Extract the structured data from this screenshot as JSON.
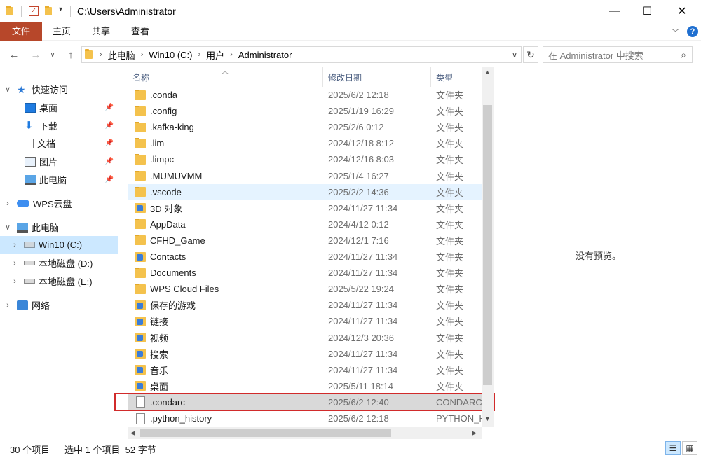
{
  "window": {
    "title": "C:\\Users\\Administrator",
    "minimize_label": "—",
    "maximize_label": "☐",
    "close_label": "✕"
  },
  "ribbon": {
    "tabs": [
      "文件",
      "主页",
      "共享",
      "查看"
    ]
  },
  "address": {
    "crumbs": [
      "此电脑",
      "Win10 (C:)",
      "用户",
      "Administrator"
    ],
    "search_placeholder": "在 Administrator 中搜索"
  },
  "nav": {
    "quick_access": "快速访问",
    "quick_items": [
      "桌面",
      "下载",
      "文档",
      "图片",
      "此电脑"
    ],
    "wps": "WPS云盘",
    "this_pc": "此电脑",
    "drives": [
      "Win10 (C:)",
      "本地磁盘 (D:)",
      "本地磁盘 (E:)"
    ],
    "network": "网络"
  },
  "list": {
    "columns": [
      "名称",
      "修改日期",
      "类型"
    ],
    "rows": [
      {
        "name": ".conda",
        "date": "2025/6/2 12:18",
        "type": "文件夹",
        "icon": "folder-icon"
      },
      {
        "name": ".config",
        "date": "2025/1/19 16:29",
        "type": "文件夹",
        "icon": "folder-icon"
      },
      {
        "name": ".kafka-king",
        "date": "2025/2/6 0:12",
        "type": "文件夹",
        "icon": "folder-icon"
      },
      {
        "name": ".lim",
        "date": "2024/12/18 8:12",
        "type": "文件夹",
        "icon": "folder-icon"
      },
      {
        "name": ".limpc",
        "date": "2024/12/16 8:03",
        "type": "文件夹",
        "icon": "folder-icon"
      },
      {
        "name": ".MUMUVMM",
        "date": "2025/1/4 16:27",
        "type": "文件夹",
        "icon": "folder-icon"
      },
      {
        "name": ".vscode",
        "date": "2025/2/2 14:36",
        "type": "文件夹",
        "icon": "folder-icon"
      },
      {
        "name": "3D 对象",
        "date": "2024/11/27 11:34",
        "type": "文件夹",
        "icon": "3d-objects-icon"
      },
      {
        "name": "AppData",
        "date": "2024/4/12 0:12",
        "type": "文件夹",
        "icon": "folder-icon"
      },
      {
        "name": "CFHD_Game",
        "date": "2024/12/1 7:16",
        "type": "文件夹",
        "icon": "folder-icon"
      },
      {
        "name": "Contacts",
        "date": "2024/11/27 11:34",
        "type": "文件夹",
        "icon": "contacts-icon"
      },
      {
        "name": "Documents",
        "date": "2024/11/27 11:34",
        "type": "文件夹",
        "icon": "folder-icon"
      },
      {
        "name": "WPS Cloud Files",
        "date": "2025/5/22 19:24",
        "type": "文件夹",
        "icon": "folder-icon"
      },
      {
        "name": "保存的游戏",
        "date": "2024/11/27 11:34",
        "type": "文件夹",
        "icon": "saved-games-icon"
      },
      {
        "name": "链接",
        "date": "2024/11/27 11:34",
        "type": "文件夹",
        "icon": "links-icon"
      },
      {
        "name": "视频",
        "date": "2024/12/3 20:36",
        "type": "文件夹",
        "icon": "videos-icon"
      },
      {
        "name": "搜索",
        "date": "2024/11/27 11:34",
        "type": "文件夹",
        "icon": "searches-icon"
      },
      {
        "name": "音乐",
        "date": "2024/11/27 11:34",
        "type": "文件夹",
        "icon": "music-icon"
      },
      {
        "name": "桌面",
        "date": "2025/5/11 18:14",
        "type": "文件夹",
        "icon": "desktop-icon"
      },
      {
        "name": ".condarc",
        "date": "2025/6/2 12:40",
        "type": "CONDARC",
        "icon": "file-icon"
      },
      {
        "name": ".python_history",
        "date": "2025/6/2 12:18",
        "type": "PYTHON_H",
        "icon": "file-icon"
      }
    ]
  },
  "preview": {
    "text": "没有预览。"
  },
  "status": {
    "count": "30 个项目",
    "selection": "选中 1 个项目  52 字节"
  }
}
